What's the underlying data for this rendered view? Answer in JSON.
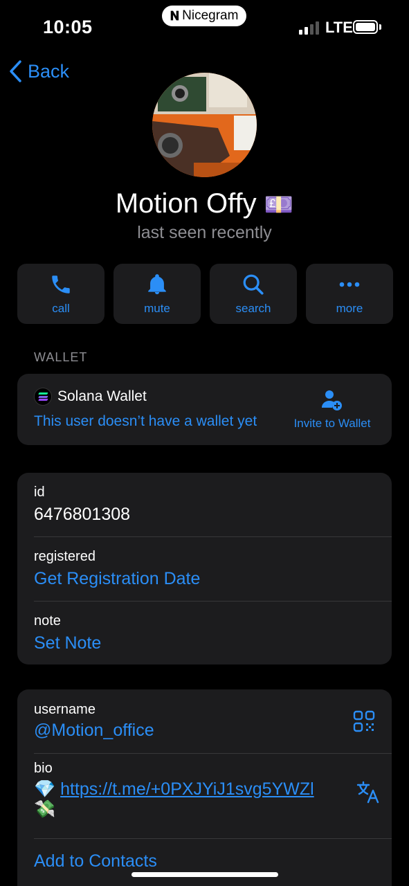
{
  "status_bar": {
    "time": "10:05",
    "app_pill": "Nicegram",
    "network": "LTE"
  },
  "nav": {
    "back_label": "Back"
  },
  "profile": {
    "name": "Motion Offy",
    "name_emoji": "💷",
    "status": "last seen recently"
  },
  "actions": [
    {
      "label": "call",
      "icon": "phone-icon"
    },
    {
      "label": "mute",
      "icon": "bell-icon"
    },
    {
      "label": "search",
      "icon": "magnifier-icon"
    },
    {
      "label": "more",
      "icon": "ellipsis-icon"
    }
  ],
  "wallet": {
    "section_label": "WALLET",
    "title": "Solana Wallet",
    "subtitle": "This user doesn’t have a wallet yet",
    "invite_label": "Invite to Wallet"
  },
  "info": {
    "id_label": "id",
    "id_value": "6476801308",
    "registered_label": "registered",
    "registered_value": "Get Registration Date",
    "note_label": "note",
    "note_value": "Set Note"
  },
  "user": {
    "username_label": "username",
    "username_value": "@Motion_office",
    "bio_label": "bio",
    "bio_emoji": "💎",
    "bio_link": "https://t.me/+0PXJYiJ1svg5YWZl",
    "bio_emoji_2": "💸",
    "add_contacts": "Add to Contacts"
  },
  "colors": {
    "accent": "#2b8ef6",
    "card": "#1c1c1e",
    "background": "#000000",
    "secondary_text": "#8e8e93"
  }
}
